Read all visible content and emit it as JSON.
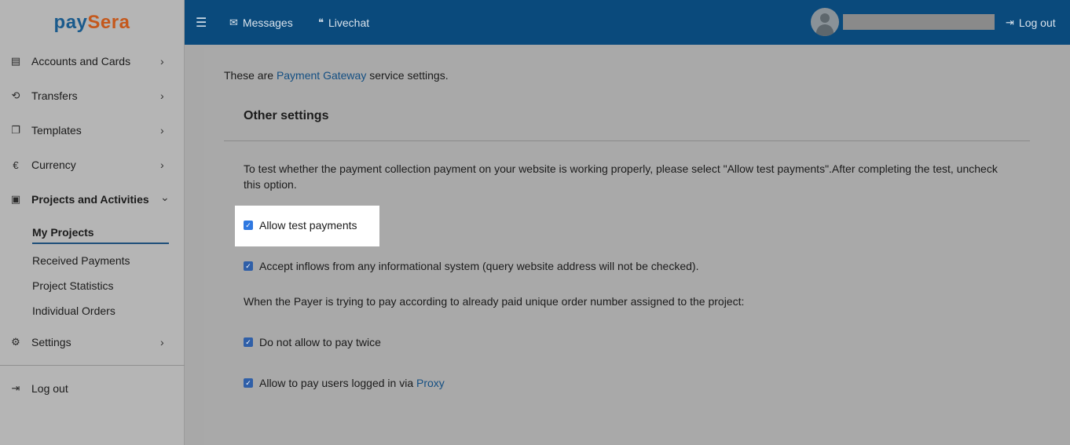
{
  "logo": {
    "part1": "pay",
    "part2": "Sera"
  },
  "sidebar": {
    "items": [
      {
        "label": "Accounts and Cards",
        "icon": "wallet-icon",
        "chevron": "›"
      },
      {
        "label": "Transfers",
        "icon": "transfer-icon",
        "chevron": "›"
      },
      {
        "label": "Templates",
        "icon": "copy-icon",
        "chevron": "›"
      },
      {
        "label": "Currency",
        "icon": "euro-icon",
        "chevron": "›"
      },
      {
        "label": "Projects and Activities",
        "icon": "clipboard-icon",
        "chevron": "⌄"
      },
      {
        "label": "Settings",
        "icon": "gear-icon",
        "chevron": "›"
      },
      {
        "label": "Log out",
        "icon": "logout-icon"
      }
    ],
    "subitems": [
      "My Projects",
      "Received Payments",
      "Project Statistics",
      "Individual Orders"
    ]
  },
  "topbar": {
    "menu_icon": "☰",
    "messages": "Messages",
    "livechat": "Livechat",
    "logout": "Log out"
  },
  "content": {
    "intro_before": "These are ",
    "intro_link": "Payment Gateway",
    "intro_after": " service settings.",
    "section_title": "Other settings",
    "description": "To test whether the payment collection payment on your website is working properly, please select \"Allow test payments\".After completing the test, uncheck this option.",
    "options": {
      "allow_test": "Allow test payments",
      "accept_inflows": "Accept inflows from any informational system (query website address will not be checked).",
      "payer_note": "When the Payer is trying to pay according to already paid unique order number assigned to the project:",
      "no_pay_twice": "Do not allow to pay twice",
      "proxy_before": "Allow to pay users logged in via ",
      "proxy_link": "Proxy"
    }
  },
  "colors": {
    "topbar": "#0a4a7c",
    "accent": "#2f5fa8",
    "link": "#144f83",
    "logo_blue": "#1a5a8c",
    "logo_orange": "#c4581c"
  }
}
